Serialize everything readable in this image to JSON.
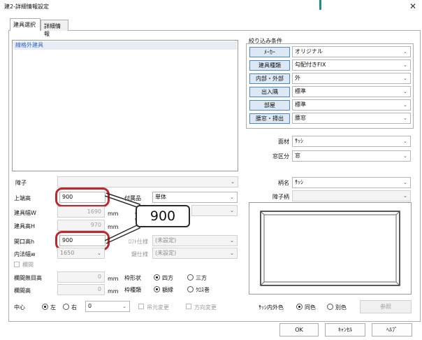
{
  "window": {
    "title": "建2-詳細情報設定"
  },
  "tabs": [
    {
      "label": "建具選択",
      "active": true
    },
    {
      "label": "詳細情報",
      "active": false
    }
  ],
  "list": {
    "items": [
      "線格外建具"
    ]
  },
  "filter": {
    "title": "絞り込み条件",
    "rows": [
      {
        "button": "ﾒｰｶｰ",
        "value": "オリジナル"
      },
      {
        "button": "建具種類",
        "value": "勾配付きFIX"
      },
      {
        "button": "内部・外部",
        "value": "外"
      },
      {
        "button": "出入隅",
        "value": "標準"
      },
      {
        "button": "部屋",
        "value": "標準"
      },
      {
        "button": "腰窓・掃出",
        "value": "腰窓"
      }
    ]
  },
  "material": {
    "label": "面材",
    "value": "ｻｯｼ"
  },
  "window_class": {
    "label": "窓区分",
    "value": "窓"
  },
  "shoji": {
    "label": "障子"
  },
  "hinmei": {
    "label": "柄名",
    "value": "ｻｯｼ"
  },
  "shoji_pattern": {
    "label": "障子柄"
  },
  "fields": {
    "top_height": {
      "label": "上端高",
      "value": "900"
    },
    "width": {
      "label": "建具幅W",
      "value": "1690"
    },
    "height": {
      "label": "建具高H",
      "value": "970"
    },
    "opening_height": {
      "label": "開口高h",
      "value": "900"
    },
    "inner_width": {
      "label": "内法幅w",
      "value": "1650"
    }
  },
  "units": {
    "mm": "mm"
  },
  "accessory": {
    "label": "付属品",
    "value": "単体"
  },
  "extras": {
    "field1_label": "ﾛﾌﾄ仕様",
    "field1_value": "(未設定)",
    "field2_label": "鍵仕様",
    "field2_value": "(未設定)"
  },
  "callout": {
    "text": "900"
  },
  "hekiki": {
    "checkbox_label": "欄間",
    "no_height_label": "欄間無目高",
    "no_height_value": "0",
    "height_label": "欄間高",
    "height_value": "0"
  },
  "frame_shape": {
    "label": "枠形状",
    "opt1": "四方",
    "opt2": "三方"
  },
  "frame_type": {
    "label": "枠種類",
    "opt1": "額縁",
    "opt2": "ｸﾛｽ巻"
  },
  "center": {
    "label": "中心",
    "opt1": "左",
    "opt2": "右",
    "value": "0"
  },
  "checks": {
    "hanging": "吊元変更",
    "direction": "方向変更"
  },
  "sash_color": {
    "label": "ｻｯｼ内外色",
    "opt1": "同色",
    "opt2": "別色",
    "ref_button": "参照"
  },
  "buttons": {
    "ok": "OK",
    "cancel": "ｷｬﾝｾﾙ",
    "help": "ﾍﾙﾌﾟ"
  },
  "colors": {
    "accent": "#4a86c8",
    "highlight": "#c0272d",
    "title_bar": "#1a8f8a"
  }
}
